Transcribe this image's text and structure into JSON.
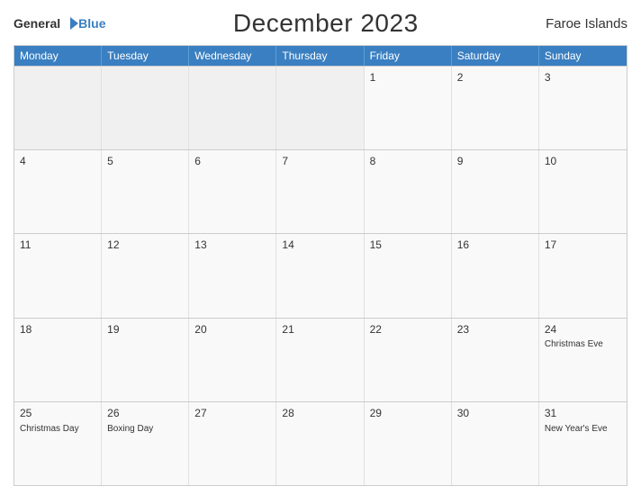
{
  "logo": {
    "general": "General",
    "blue": "Blue"
  },
  "header": {
    "title": "December 2023",
    "region": "Faroe Islands"
  },
  "weekdays": [
    "Monday",
    "Tuesday",
    "Wednesday",
    "Thursday",
    "Friday",
    "Saturday",
    "Sunday"
  ],
  "weeks": [
    [
      {
        "day": "",
        "event": ""
      },
      {
        "day": "",
        "event": ""
      },
      {
        "day": "",
        "event": ""
      },
      {
        "day": "",
        "event": ""
      },
      {
        "day": "1",
        "event": ""
      },
      {
        "day": "2",
        "event": ""
      },
      {
        "day": "3",
        "event": ""
      }
    ],
    [
      {
        "day": "4",
        "event": ""
      },
      {
        "day": "5",
        "event": ""
      },
      {
        "day": "6",
        "event": ""
      },
      {
        "day": "7",
        "event": ""
      },
      {
        "day": "8",
        "event": ""
      },
      {
        "day": "9",
        "event": ""
      },
      {
        "day": "10",
        "event": ""
      }
    ],
    [
      {
        "day": "11",
        "event": ""
      },
      {
        "day": "12",
        "event": ""
      },
      {
        "day": "13",
        "event": ""
      },
      {
        "day": "14",
        "event": ""
      },
      {
        "day": "15",
        "event": ""
      },
      {
        "day": "16",
        "event": ""
      },
      {
        "day": "17",
        "event": ""
      }
    ],
    [
      {
        "day": "18",
        "event": ""
      },
      {
        "day": "19",
        "event": ""
      },
      {
        "day": "20",
        "event": ""
      },
      {
        "day": "21",
        "event": ""
      },
      {
        "day": "22",
        "event": ""
      },
      {
        "day": "23",
        "event": ""
      },
      {
        "day": "24",
        "event": "Christmas Eve"
      }
    ],
    [
      {
        "day": "25",
        "event": "Christmas Day"
      },
      {
        "day": "26",
        "event": "Boxing Day"
      },
      {
        "day": "27",
        "event": ""
      },
      {
        "day": "28",
        "event": ""
      },
      {
        "day": "29",
        "event": ""
      },
      {
        "day": "30",
        "event": ""
      },
      {
        "day": "31",
        "event": "New Year's Eve"
      }
    ]
  ]
}
